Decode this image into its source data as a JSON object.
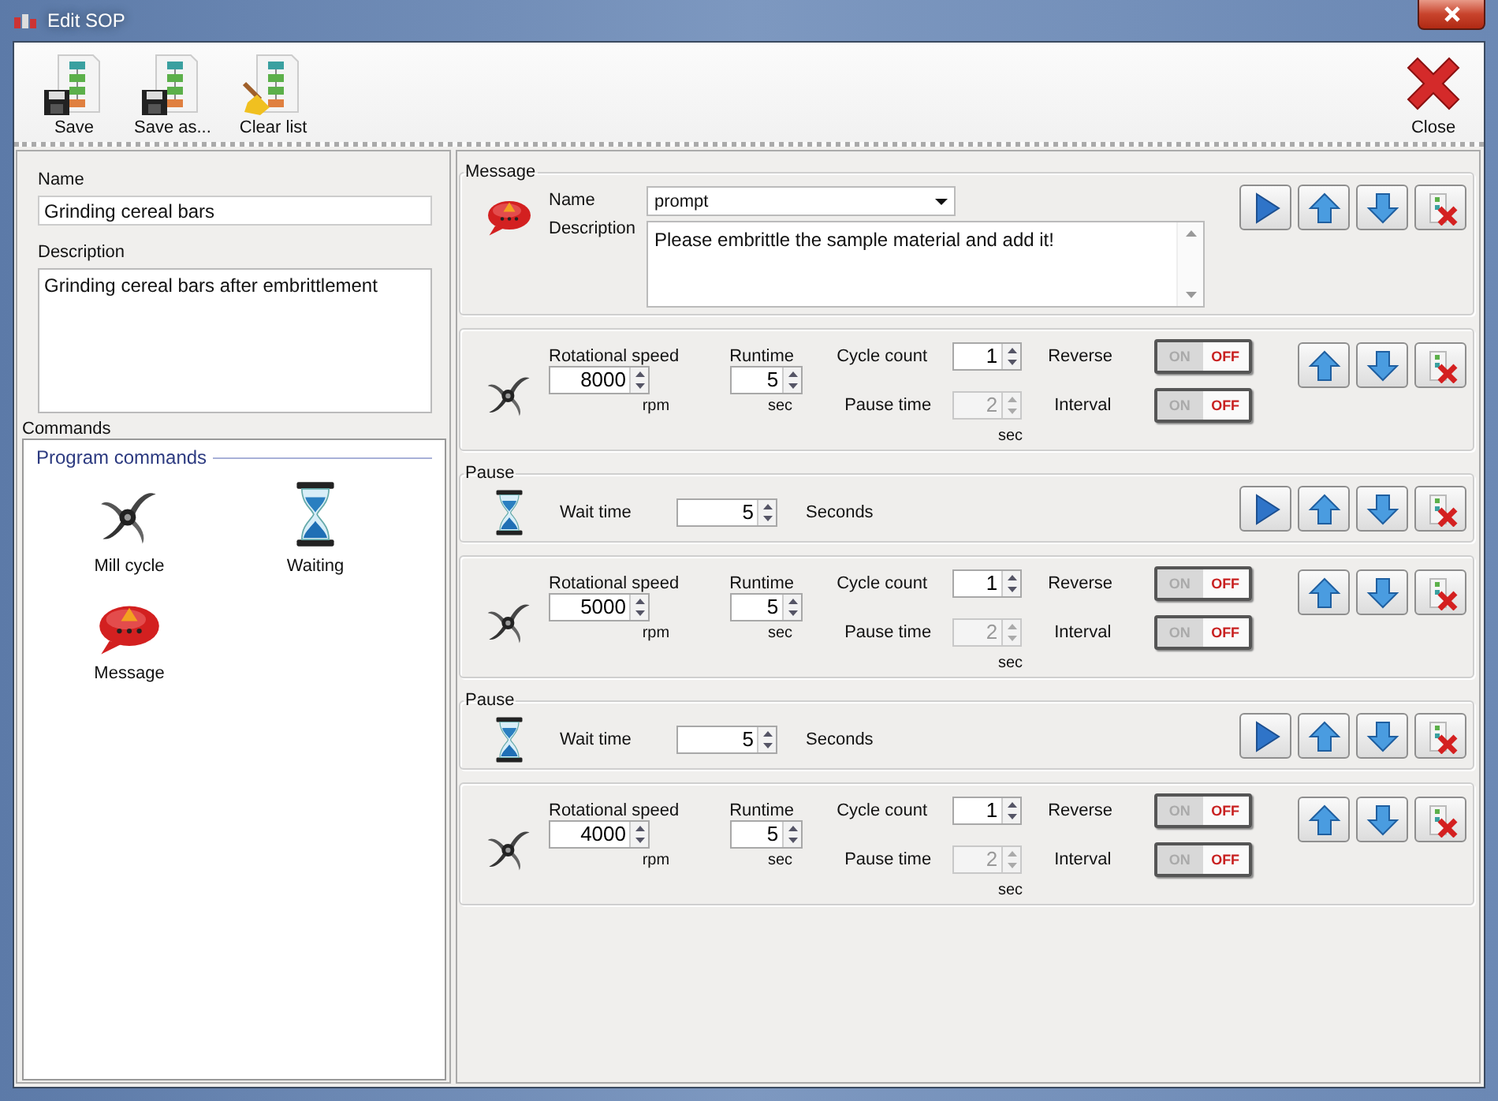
{
  "window": {
    "title": "Edit SOP"
  },
  "toolbar": {
    "left": [
      {
        "kind": "save",
        "label": "Save"
      },
      {
        "kind": "save_as",
        "label": "Save as..."
      },
      {
        "kind": "clear",
        "label": "Clear list"
      }
    ],
    "right": [
      {
        "kind": "close",
        "label": "Close"
      }
    ]
  },
  "sop": {
    "name_label": "Name",
    "name": "Grinding cereal bars",
    "description_label": "Description",
    "description": "Grinding cereal bars after embrittlement"
  },
  "commands": {
    "title": "Commands",
    "section": "Program commands",
    "items": [
      {
        "kind": "mill",
        "label": "Mill cycle"
      },
      {
        "kind": "pause",
        "label": "Waiting"
      },
      {
        "kind": "message",
        "label": "Message"
      }
    ]
  },
  "steps": [
    {
      "kind": "message",
      "title": "Message",
      "name_label": "Name",
      "name": "prompt",
      "description_label": "Description",
      "description": "Please embrittle the sample material and add it!",
      "buttons": [
        {
          "kind": "play"
        },
        {
          "kind": "up"
        },
        {
          "kind": "down"
        },
        {
          "kind": "delete"
        }
      ]
    },
    {
      "kind": "mill",
      "speed_label": "Rotational speed",
      "speed": "8000",
      "speed_unit": "rpm",
      "runtime_label": "Runtime",
      "runtime": "5",
      "runtime_unit": "sec",
      "cycle_label": "Cycle count",
      "cycle": "1",
      "pause_label": "Pause time",
      "pause": "2",
      "pause_disabled": true,
      "pause_unit": "sec",
      "toggles": [
        {
          "label": "Reverse",
          "on": false,
          "on_text": "ON",
          "off_text": "OFF"
        },
        {
          "label": "Interval",
          "on": false,
          "on_text": "ON",
          "off_text": "OFF"
        }
      ],
      "buttons": [
        {
          "kind": "up"
        },
        {
          "kind": "down"
        },
        {
          "kind": "delete"
        }
      ]
    },
    {
      "kind": "pause",
      "title": "Pause",
      "wait_label": "Wait time",
      "wait": "5",
      "wait_unit": "Seconds",
      "buttons": [
        {
          "kind": "play"
        },
        {
          "kind": "up"
        },
        {
          "kind": "down"
        },
        {
          "kind": "delete"
        }
      ]
    },
    {
      "kind": "mill",
      "speed_label": "Rotational speed",
      "speed": "5000",
      "speed_unit": "rpm",
      "runtime_label": "Runtime",
      "runtime": "5",
      "runtime_unit": "sec",
      "cycle_label": "Cycle count",
      "cycle": "1",
      "pause_label": "Pause time",
      "pause": "2",
      "pause_disabled": true,
      "pause_unit": "sec",
      "toggles": [
        {
          "label": "Reverse",
          "on": false,
          "on_text": "ON",
          "off_text": "OFF"
        },
        {
          "label": "Interval",
          "on": false,
          "on_text": "ON",
          "off_text": "OFF"
        }
      ],
      "buttons": [
        {
          "kind": "up"
        },
        {
          "kind": "down"
        },
        {
          "kind": "delete"
        }
      ]
    },
    {
      "kind": "pause",
      "title": "Pause",
      "wait_label": "Wait time",
      "wait": "5",
      "wait_unit": "Seconds",
      "buttons": [
        {
          "kind": "play"
        },
        {
          "kind": "up"
        },
        {
          "kind": "down"
        },
        {
          "kind": "delete"
        }
      ]
    },
    {
      "kind": "mill",
      "speed_label": "Rotational speed",
      "speed": "4000",
      "speed_unit": "rpm",
      "runtime_label": "Runtime",
      "runtime": "5",
      "runtime_unit": "sec",
      "cycle_label": "Cycle count",
      "cycle": "1",
      "pause_label": "Pause time",
      "pause": "2",
      "pause_disabled": true,
      "pause_unit": "sec",
      "toggles": [
        {
          "label": "Reverse",
          "on": false,
          "on_text": "ON",
          "off_text": "OFF"
        },
        {
          "label": "Interval",
          "on": false,
          "on_text": "ON",
          "off_text": "OFF"
        }
      ],
      "buttons": [
        {
          "kind": "up"
        },
        {
          "kind": "down"
        },
        {
          "kind": "delete"
        }
      ]
    }
  ]
}
